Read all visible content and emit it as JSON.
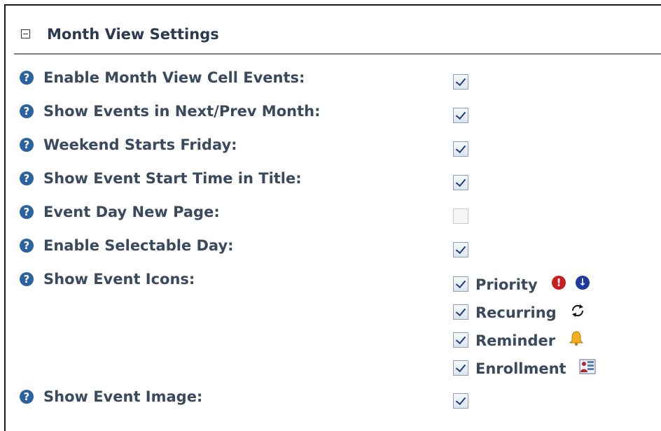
{
  "section": {
    "title": "Month View Settings"
  },
  "rows": [
    {
      "label": "Enable Month View Cell Events:",
      "checked": true
    },
    {
      "label": "Show Events in Next/Prev Month:",
      "checked": true
    },
    {
      "label": "Weekend Starts Friday:",
      "checked": true
    },
    {
      "label": "Show Event Start Time in Title:",
      "checked": true
    },
    {
      "label": "Event Day New Page:",
      "checked": false
    },
    {
      "label": "Enable Selectable Day:",
      "checked": true
    },
    {
      "label": "Show Event Icons:"
    },
    {
      "label": "Show Event Image:",
      "checked": true
    }
  ],
  "event_icons": [
    {
      "label": "Priority",
      "checked": true,
      "icons": [
        "priority-high-icon",
        "priority-low-icon"
      ]
    },
    {
      "label": "Recurring",
      "checked": true,
      "icons": [
        "recurring-icon"
      ]
    },
    {
      "label": "Reminder",
      "checked": true,
      "icons": [
        "bell-icon"
      ]
    },
    {
      "label": "Enrollment",
      "checked": true,
      "icons": [
        "enrollment-icon"
      ]
    }
  ],
  "help_icon_glyph": "?",
  "priority_high_glyph": "!",
  "priority_low_glyph": "↓",
  "colors": {
    "label_text": "#3a4a5e",
    "help_icon": "#2c62a0",
    "priority_high": "#c81e1e",
    "priority_low": "#1e3a9a",
    "bell": "#f2b01e"
  }
}
